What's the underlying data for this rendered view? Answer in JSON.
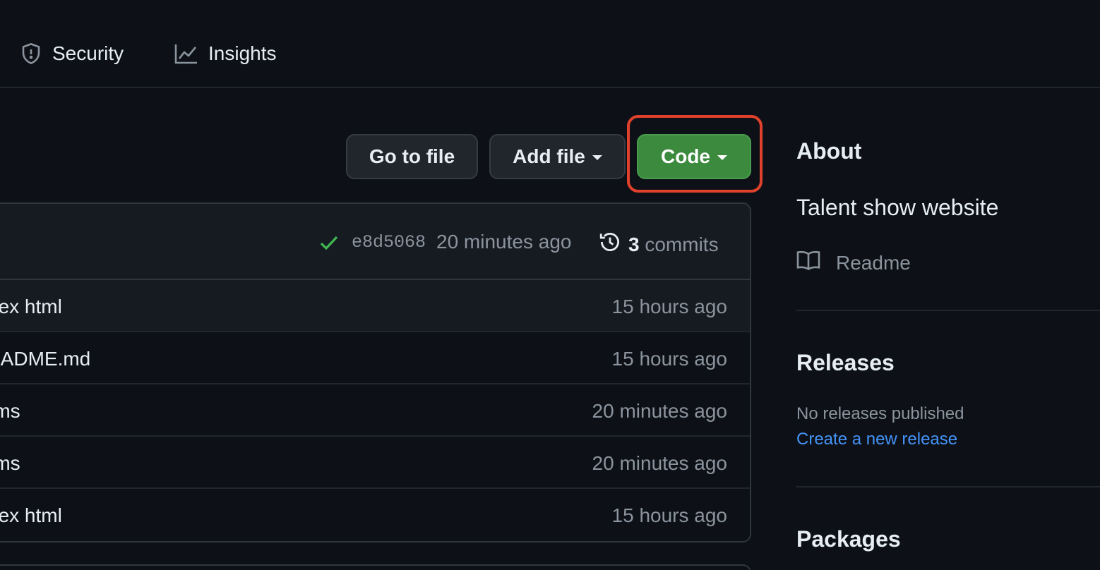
{
  "nav": {
    "security_label": "Security",
    "insights_label": "Insights"
  },
  "actions": {
    "go_to_file": "Go to file",
    "add_file": "Add file",
    "code": "Code"
  },
  "colors": {
    "background": "#0d1117",
    "code_button": "#3b8a3d",
    "highlight_box": "#e0412c",
    "link": "#4493f8",
    "check": "#3fb950"
  },
  "commit": {
    "sha": "e8d5068",
    "time": "20 minutes ago",
    "count": "3",
    "count_label": "commits"
  },
  "files": [
    {
      "name": "dex html",
      "time": "15 hours ago"
    },
    {
      "name": "EADME.md",
      "time": "15 hours ago"
    },
    {
      "name": "rms",
      "time": "20 minutes ago"
    },
    {
      "name": "rms",
      "time": "20 minutes ago"
    },
    {
      "name": "dex html",
      "time": "15 hours ago"
    }
  ],
  "sidebar": {
    "about_heading": "About",
    "description": "Talent show website",
    "readme_label": "Readme",
    "releases_heading": "Releases",
    "no_releases": "No releases published",
    "create_release": "Create a new release",
    "packages_heading": "Packages"
  }
}
